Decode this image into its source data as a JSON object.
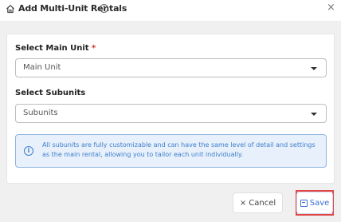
{
  "header": {
    "title": "Add Multi-Unit Rentals",
    "help_glyph": "?",
    "close_glyph": "×"
  },
  "form": {
    "main_unit": {
      "label": "Select Main Unit",
      "required_mark": "*",
      "value": "Main Unit"
    },
    "subunits": {
      "label": "Select Subunits",
      "value": "Subunits"
    },
    "info": {
      "glyph": "i",
      "text": "All subunits are fully customizable and can have the same level of detail and settings as the main rental, allowing you to tailor each unit individually."
    }
  },
  "footer": {
    "cancel_label": "Cancel",
    "cancel_glyph": "×",
    "save_label": "Save"
  },
  "colors": {
    "accent": "#3a6fd6",
    "info_bg": "#e7f0fb",
    "required": "#d32f2f",
    "highlight": "#e04646"
  }
}
